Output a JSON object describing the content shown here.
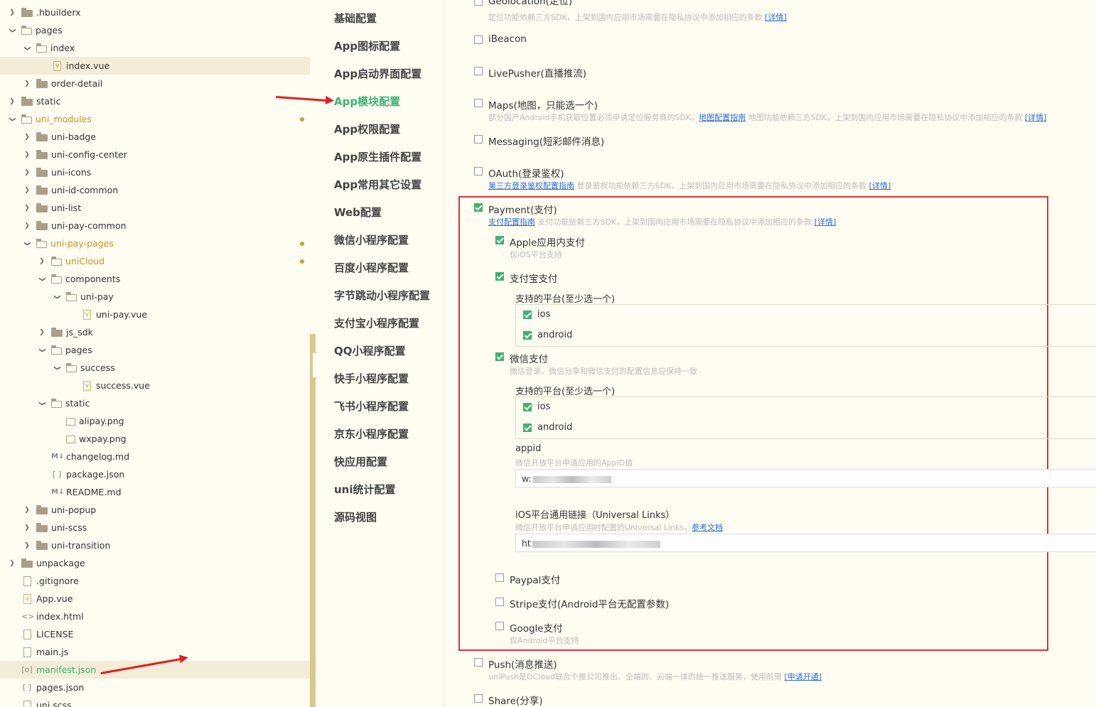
{
  "tree": {
    "items": [
      {
        "label": ".hbuilderx",
        "icon": "folder-icon",
        "depth": 0,
        "chevron": "right"
      },
      {
        "label": "pages",
        "icon": "folder-open-icon",
        "depth": 0,
        "chevron": "down"
      },
      {
        "label": "index",
        "icon": "folder-open-icon",
        "depth": 1,
        "chevron": "down"
      },
      {
        "label": "index.vue",
        "icon": "vue-file-icon",
        "depth": 2,
        "chevron": "",
        "selected": true
      },
      {
        "label": "order-detail",
        "icon": "folder-icon",
        "depth": 1,
        "chevron": "right"
      },
      {
        "label": "static",
        "icon": "folder-icon",
        "depth": 0,
        "chevron": "right"
      },
      {
        "label": "uni_modules",
        "icon": "folder-open-icon",
        "depth": 0,
        "chevron": "down",
        "modified": true
      },
      {
        "label": "uni-badge",
        "icon": "folder-icon",
        "depth": 1,
        "chevron": "right"
      },
      {
        "label": "uni-config-center",
        "icon": "folder-icon",
        "depth": 1,
        "chevron": "right"
      },
      {
        "label": "uni-icons",
        "icon": "folder-icon",
        "depth": 1,
        "chevron": "right"
      },
      {
        "label": "uni-id-common",
        "icon": "folder-icon",
        "depth": 1,
        "chevron": "right"
      },
      {
        "label": "uni-list",
        "icon": "folder-icon",
        "depth": 1,
        "chevron": "right"
      },
      {
        "label": "uni-pay-common",
        "icon": "folder-icon",
        "depth": 1,
        "chevron": "right"
      },
      {
        "label": "uni-pay-pages",
        "icon": "folder-open-icon",
        "depth": 1,
        "chevron": "down",
        "modified": true
      },
      {
        "label": "uniCloud",
        "icon": "cloud-folder-icon",
        "depth": 2,
        "chevron": "right",
        "modified": true
      },
      {
        "label": "components",
        "icon": "folder-open-icon",
        "depth": 2,
        "chevron": "down"
      },
      {
        "label": "uni-pay",
        "icon": "folder-open-icon",
        "depth": 3,
        "chevron": "down"
      },
      {
        "label": "uni-pay.vue",
        "icon": "vue-file-icon",
        "depth": 4,
        "chevron": ""
      },
      {
        "label": "js_sdk",
        "icon": "folder-icon",
        "depth": 2,
        "chevron": "right"
      },
      {
        "label": "pages",
        "icon": "folder-open-icon",
        "depth": 2,
        "chevron": "down"
      },
      {
        "label": "success",
        "icon": "folder-open-icon",
        "depth": 3,
        "chevron": "down"
      },
      {
        "label": "success.vue",
        "icon": "vue-file-icon",
        "depth": 4,
        "chevron": ""
      },
      {
        "label": "static",
        "icon": "folder-open-icon",
        "depth": 2,
        "chevron": "down"
      },
      {
        "label": "alipay.png",
        "icon": "image-file-icon",
        "depth": 3,
        "chevron": ""
      },
      {
        "label": "wxpay.png",
        "icon": "image-file-icon",
        "depth": 3,
        "chevron": ""
      },
      {
        "label": "changelog.md",
        "icon": "markdown-file-icon",
        "depth": 2,
        "chevron": ""
      },
      {
        "label": "package.json",
        "icon": "json-file-icon",
        "depth": 2,
        "chevron": ""
      },
      {
        "label": "README.md",
        "icon": "markdown-file-icon",
        "depth": 2,
        "chevron": ""
      },
      {
        "label": "uni-popup",
        "icon": "folder-icon",
        "depth": 1,
        "chevron": "right"
      },
      {
        "label": "uni-scss",
        "icon": "folder-icon",
        "depth": 1,
        "chevron": "right"
      },
      {
        "label": "uni-transition",
        "icon": "folder-icon",
        "depth": 1,
        "chevron": "right"
      },
      {
        "label": "unpackage",
        "icon": "folder-icon",
        "depth": 0,
        "chevron": "right"
      },
      {
        "label": ".gitignore",
        "icon": "file-icon",
        "depth": 0,
        "chevron": ""
      },
      {
        "label": "App.vue",
        "icon": "vue-file-icon",
        "depth": 0,
        "chevron": ""
      },
      {
        "label": "index.html",
        "icon": "html-file-icon",
        "depth": 0,
        "chevron": ""
      },
      {
        "label": "LICENSE",
        "icon": "file-icon",
        "depth": 0,
        "chevron": ""
      },
      {
        "label": "main.js",
        "icon": "file-icon",
        "depth": 0,
        "chevron": ""
      },
      {
        "label": "manifest.json",
        "icon": "manifest-file-icon",
        "depth": 0,
        "chevron": "",
        "active": true
      },
      {
        "label": "pages.json",
        "icon": "json-file-icon",
        "depth": 0,
        "chevron": ""
      },
      {
        "label": "uni.scss",
        "icon": "file-icon",
        "depth": 0,
        "chevron": ""
      }
    ]
  },
  "nav": {
    "items": [
      {
        "label": "基础配置"
      },
      {
        "label": "App图标配置"
      },
      {
        "label": "App启动界面配置"
      },
      {
        "label": "App模块配置",
        "active": true
      },
      {
        "label": "App权限配置"
      },
      {
        "label": "App原生插件配置"
      },
      {
        "label": "App常用其它设置"
      },
      {
        "label": "Web配置"
      },
      {
        "label": "微信小程序配置"
      },
      {
        "label": "百度小程序配置"
      },
      {
        "label": "字节跳动小程序配置"
      },
      {
        "label": "支付宝小程序配置"
      },
      {
        "label": "QQ小程序配置"
      },
      {
        "label": "快手小程序配置"
      },
      {
        "label": "飞书小程序配置"
      },
      {
        "label": "京东小程序配置"
      },
      {
        "label": "快应用配置"
      },
      {
        "label": "uni统计配置"
      },
      {
        "label": "源码视图"
      }
    ]
  },
  "modules": {
    "geolocation": {
      "label": "Geolocation(定位)",
      "desc": "定位功能依赖三方SDK，上架到国内应用市场需要在隐私协议中添加相应的条款",
      "link": "[详情]",
      "checked": false
    },
    "ibeacon": {
      "label": "iBeacon",
      "checked": false
    },
    "livepusher": {
      "label": "LivePusher(直播推流)",
      "checked": false
    },
    "maps": {
      "label": "Maps(地图，只能选一个)",
      "desc1": "部分国产Android手机获取位置必须申请定位服务商的SDK。",
      "link1": "地图配置指南",
      "desc2": "地图功能依赖三方SDK，上架到国内应用市场需要在隐私协议中添加相应的条款",
      "link2": "[详情]",
      "checked": false
    },
    "messaging": {
      "label": "Messaging(短彩邮件消息)",
      "checked": false
    },
    "oauth": {
      "label": "OAuth(登录鉴权)",
      "link1": "第三方登录鉴权配置指南",
      "desc": "登录鉴权功能依赖三方SDK，上架到国内应用市场需要在隐私协议中添加相应的条款",
      "link2": "[详情]",
      "checked": false
    },
    "payment": {
      "label": "Payment(支付)",
      "link1": "支付配置指南",
      "desc": "支付功能依赖三方SDK，上架到国内应用市场需要在隐私协议中添加相应的条款",
      "link2": "[详情]",
      "checked": true,
      "apple": {
        "label": "Apple应用内支付",
        "desc": "仅iOS平台支持",
        "checked": true
      },
      "alipay": {
        "label": "支付宝支付",
        "checked": true,
        "platforms_label": "支持的平台(至少选一个)",
        "ios": "ios",
        "android": "android"
      },
      "wxpay": {
        "label": "微信支付",
        "desc": "微信登录、微信分享和微信支付的配置信息应保持一致",
        "checked": true,
        "platforms_label": "支持的平台(至少选一个)",
        "ios": "ios",
        "android": "android",
        "appid_label": "appid",
        "appid_desc": "微信开放平台申请应用的AppID值",
        "appid_value": "w:",
        "ul_label": "iOS平台通用链接（Universal Links）",
        "ul_desc": "微信开放平台申请应用时配置的Universal Links，",
        "ul_link": "参考文档",
        "ul_value": "ht"
      },
      "paypal": {
        "label": "Paypal支付",
        "checked": false
      },
      "stripe": {
        "label": "Stripe支付(Android平台无配置参数)",
        "checked": false
      },
      "google": {
        "label": "Google支付",
        "desc": "仅Android平台支持",
        "checked": false
      }
    },
    "push": {
      "label": "Push(消息推送)",
      "desc": "uniPush是DCloud联合个推公司推出、全端的、云端一体的统一推送服务，使用前需",
      "link": "[申请开通]",
      "checked": false
    },
    "share": {
      "label": "Share(分享)",
      "checked": false
    }
  },
  "colors": {
    "accent": "#3cb371",
    "highlight": "#e0303a",
    "link": "#2a6fd6",
    "modified": "#c8941f"
  }
}
